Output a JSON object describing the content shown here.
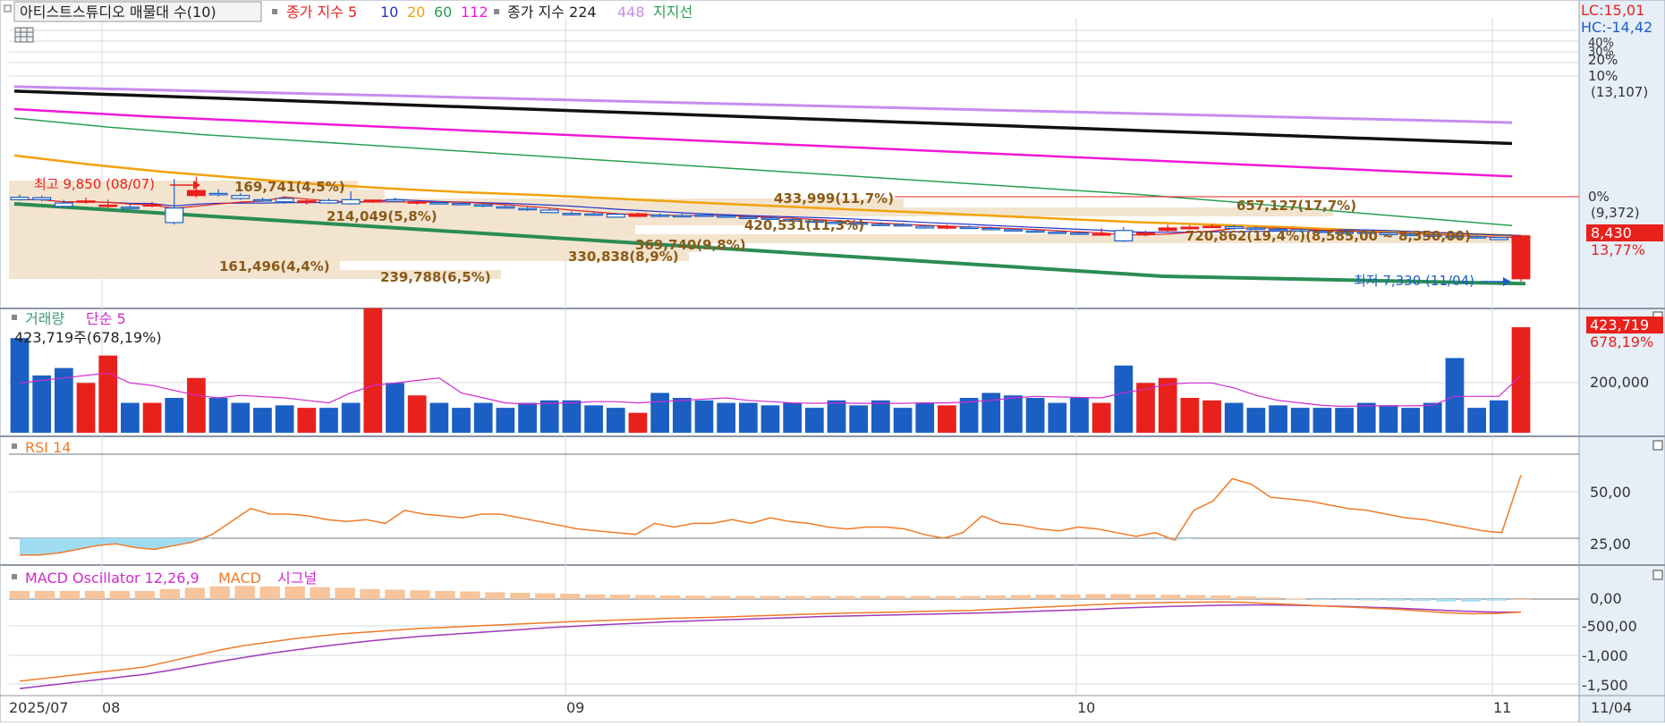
{
  "colors": {
    "up": "#e8211d",
    "down": "#1b5fc4",
    "ma5": "#e8211d",
    "ma10": "#2233cc",
    "ma20": "#f2a20c",
    "ma60": "#28a050",
    "ma112": "#f218d8",
    "ma224": "#111111",
    "ma448": "#c78cf0",
    "support": "#2b8c55",
    "volume_ma": "#d02ad0",
    "rsi": "#f07a28",
    "rsi_fill": "#9fdcf2",
    "macd": "#f07a28",
    "signal": "#a03ab8",
    "osc_pos": "#f7c49c",
    "osc_neg": "#a6def2",
    "axis_bg": "#e6eef8",
    "highlight_bg": "#e8211d",
    "profile_bar": "#f3e4cf"
  },
  "price_panel": {
    "legend": {
      "stock_label": "아티스트스튜디오 매물대 수(10)",
      "ma_prefix": "종가 지수 5",
      "ma10": "10",
      "ma20": "20",
      "ma60": "60",
      "ma112": "112",
      "ma224": "종가 지수 224",
      "ma448": "448",
      "support": "지지선"
    },
    "lc_label": "LC:15,01",
    "hc_label": "HC:-14,42",
    "axis_pct_labels": [
      "40%",
      "30%",
      "20%",
      "10%"
    ],
    "axis_pct_value": "(13,107)",
    "axis_zero_label": "0%",
    "axis_zero_value": "(9,372)",
    "current_price": "8,430",
    "current_change": "13,77%",
    "high_label": "최고 9,850 (08/07)",
    "low_label": "최저 7,330 (11/04)",
    "profile_labels": [
      "169,741(4,5%)",
      "214,049(5,8%)",
      "433,999(11,7%)",
      "657,127(17,7%)",
      "420,531(11,3%)",
      "369,740(9,8%)",
      "330,838(8,9%)",
      "161,496(4,4%)",
      "239,788(6,5%)",
      "720,862(19,4%)(8,585,00 ~ 8,350,00)"
    ]
  },
  "volume_panel": {
    "legend_name": "거래량",
    "legend_ma": "단순 5",
    "current_label": "423,719주(678,19%)",
    "axis_value": "423,719",
    "axis_pct": "678,19%",
    "axis_ticks": [
      "200,000"
    ]
  },
  "rsi_panel": {
    "legend": "RSI 14",
    "axis_ticks": [
      "50,00",
      "25,00"
    ]
  },
  "macd_panel": {
    "legend_osc": "MACD Oscillator 12,26,9",
    "legend_macd": "MACD",
    "legend_signal": "시그널",
    "axis_ticks": [
      "0,00",
      "-500,00",
      "-1,000",
      "-1,500"
    ]
  },
  "x_axis": {
    "labels": [
      "2025/07",
      "08",
      "09",
      "10",
      "11"
    ],
    "end_label": "11/04"
  },
  "chart_data": {
    "type": "candlestick",
    "candles": [
      {
        "o": 9360,
        "h": 9420,
        "l": 9280,
        "c": 9300
      },
      {
        "o": 9350,
        "h": 9400,
        "l": 9260,
        "c": 9300
      },
      {
        "o": 9220,
        "h": 9300,
        "l": 9120,
        "c": 9140
      },
      {
        "o": 9250,
        "h": 9350,
        "l": 9200,
        "c": 9270
      },
      {
        "o": 9160,
        "h": 9300,
        "l": 9100,
        "c": 9170
      },
      {
        "o": 9120,
        "h": 9200,
        "l": 9070,
        "c": 9100
      },
      {
        "o": 9180,
        "h": 9250,
        "l": 9120,
        "c": 9180
      },
      {
        "o": 9100,
        "h": 9800,
        "l": 8700,
        "c": 8750
      },
      {
        "o": 9400,
        "h": 9850,
        "l": 9350,
        "c": 9520
      },
      {
        "o": 9450,
        "h": 9550,
        "l": 9380,
        "c": 9430
      },
      {
        "o": 9400,
        "h": 9460,
        "l": 9300,
        "c": 9330
      },
      {
        "o": 9300,
        "h": 9350,
        "l": 9250,
        "c": 9290
      },
      {
        "o": 9330,
        "h": 9380,
        "l": 9200,
        "c": 9250
      },
      {
        "o": 9260,
        "h": 9320,
        "l": 9180,
        "c": 9270
      },
      {
        "o": 9280,
        "h": 9330,
        "l": 9200,
        "c": 9220
      },
      {
        "o": 9300,
        "h": 9500,
        "l": 9180,
        "c": 9200
      },
      {
        "o": 9250,
        "h": 9310,
        "l": 9220,
        "c": 9290
      },
      {
        "o": 9300,
        "h": 9350,
        "l": 9240,
        "c": 9260
      },
      {
        "o": 9230,
        "h": 9290,
        "l": 9180,
        "c": 9250
      },
      {
        "o": 9230,
        "h": 9260,
        "l": 9190,
        "c": 9210
      },
      {
        "o": 9210,
        "h": 9250,
        "l": 9170,
        "c": 9190
      },
      {
        "o": 9180,
        "h": 9220,
        "l": 9120,
        "c": 9150
      },
      {
        "o": 9130,
        "h": 9180,
        "l": 9080,
        "c": 9100
      },
      {
        "o": 9090,
        "h": 9130,
        "l": 9030,
        "c": 9060
      },
      {
        "o": 9050,
        "h": 9090,
        "l": 8980,
        "c": 8990
      },
      {
        "o": 8970,
        "h": 9020,
        "l": 8920,
        "c": 8950
      },
      {
        "o": 8960,
        "h": 9010,
        "l": 8920,
        "c": 8940
      },
      {
        "o": 8950,
        "h": 8990,
        "l": 8860,
        "c": 8880
      },
      {
        "o": 8900,
        "h": 8990,
        "l": 8880,
        "c": 8960
      },
      {
        "o": 8930,
        "h": 8970,
        "l": 8880,
        "c": 8920
      },
      {
        "o": 8920,
        "h": 8960,
        "l": 8880,
        "c": 8900
      },
      {
        "o": 8930,
        "h": 8960,
        "l": 8880,
        "c": 8910
      },
      {
        "o": 8910,
        "h": 8940,
        "l": 8860,
        "c": 8880
      },
      {
        "o": 8880,
        "h": 8920,
        "l": 8840,
        "c": 8860
      },
      {
        "o": 8860,
        "h": 8900,
        "l": 8810,
        "c": 8830
      },
      {
        "o": 8820,
        "h": 8860,
        "l": 8770,
        "c": 8790
      },
      {
        "o": 8790,
        "h": 8830,
        "l": 8740,
        "c": 8760
      },
      {
        "o": 8760,
        "h": 8800,
        "l": 8710,
        "c": 8730
      },
      {
        "o": 8740,
        "h": 8780,
        "l": 8700,
        "c": 8720
      },
      {
        "o": 8710,
        "h": 8760,
        "l": 8660,
        "c": 8680
      },
      {
        "o": 8700,
        "h": 8740,
        "l": 8650,
        "c": 8670
      },
      {
        "o": 8660,
        "h": 8700,
        "l": 8600,
        "c": 8620
      },
      {
        "o": 8640,
        "h": 8700,
        "l": 8590,
        "c": 8650
      },
      {
        "o": 8640,
        "h": 8680,
        "l": 8600,
        "c": 8620
      },
      {
        "o": 8610,
        "h": 8650,
        "l": 8560,
        "c": 8580
      },
      {
        "o": 8580,
        "h": 8620,
        "l": 8540,
        "c": 8560
      },
      {
        "o": 8550,
        "h": 8590,
        "l": 8500,
        "c": 8520
      },
      {
        "o": 8520,
        "h": 8560,
        "l": 8480,
        "c": 8500
      },
      {
        "o": 8500,
        "h": 8540,
        "l": 8450,
        "c": 8470
      },
      {
        "o": 8480,
        "h": 8620,
        "l": 8470,
        "c": 8480
      },
      {
        "o": 8560,
        "h": 8640,
        "l": 8280,
        "c": 8310
      },
      {
        "o": 8480,
        "h": 8560,
        "l": 8420,
        "c": 8500
      },
      {
        "o": 8560,
        "h": 8700,
        "l": 8520,
        "c": 8620
      },
      {
        "o": 8600,
        "h": 8690,
        "l": 8580,
        "c": 8640
      },
      {
        "o": 8660,
        "h": 8720,
        "l": 8620,
        "c": 8660
      },
      {
        "o": 8650,
        "h": 8700,
        "l": 8580,
        "c": 8610
      },
      {
        "o": 8620,
        "h": 8660,
        "l": 8560,
        "c": 8600
      },
      {
        "o": 8590,
        "h": 8630,
        "l": 8530,
        "c": 8560
      },
      {
        "o": 8580,
        "h": 8610,
        "l": 8520,
        "c": 8540
      },
      {
        "o": 8540,
        "h": 8580,
        "l": 8500,
        "c": 8520
      },
      {
        "o": 8520,
        "h": 8560,
        "l": 8480,
        "c": 8510
      },
      {
        "o": 8520,
        "h": 8550,
        "l": 8470,
        "c": 8490
      },
      {
        "o": 8500,
        "h": 8530,
        "l": 8440,
        "c": 8460
      },
      {
        "o": 8470,
        "h": 8510,
        "l": 8420,
        "c": 8440
      },
      {
        "o": 8450,
        "h": 8480,
        "l": 8390,
        "c": 8420
      },
      {
        "o": 8420,
        "h": 8460,
        "l": 8380,
        "c": 8400
      },
      {
        "o": 8410,
        "h": 8440,
        "l": 8360,
        "c": 8380
      },
      {
        "o": 8390,
        "h": 8400,
        "l": 8330,
        "c": 8340
      },
      {
        "o": 7400,
        "h": 8430,
        "l": 7330,
        "c": 8430
      }
    ],
    "volume": [
      380000,
      230000,
      260000,
      200000,
      310000,
      120000,
      120000,
      140000,
      220000,
      140000,
      120000,
      100000,
      110000,
      100000,
      100000,
      120000,
      500000,
      200000,
      150000,
      120000,
      100000,
      120000,
      100000,
      120000,
      130000,
      130000,
      110000,
      100000,
      80000,
      160000,
      140000,
      130000,
      120000,
      120000,
      110000,
      120000,
      100000,
      130000,
      110000,
      130000,
      100000,
      120000,
      110000,
      140000,
      160000,
      150000,
      140000,
      120000,
      140000,
      120000,
      270000,
      200000,
      220000,
      140000,
      130000,
      120000,
      100000,
      110000,
      100000,
      100000,
      100000,
      120000,
      110000,
      100000,
      120000,
      300000,
      100000,
      130000,
      423719
    ],
    "volume_ma5": [
      200000,
      210000,
      220000,
      230000,
      240000,
      200000,
      190000,
      170000,
      150000,
      140000,
      150000,
      145000,
      140000,
      130000,
      120000,
      160000,
      190000,
      200000,
      210000,
      220000,
      160000,
      140000,
      120000,
      115000,
      118000,
      120000,
      125000,
      125000,
      120000,
      125000,
      130000,
      135000,
      140000,
      130000,
      125000,
      120000,
      118000,
      120000,
      118000,
      118000,
      118000,
      120000,
      120000,
      124000,
      130000,
      140000,
      146000,
      144000,
      142000,
      140000,
      160000,
      175000,
      195000,
      200000,
      200000,
      180000,
      150000,
      130000,
      120000,
      110000,
      106000,
      108000,
      108000,
      108000,
      110000,
      146000,
      146000,
      146000,
      230000
    ],
    "rsi14": [
      16,
      16,
      17,
      19,
      21,
      22,
      20,
      19,
      21,
      23,
      27,
      34,
      41,
      38,
      38,
      37,
      35,
      34,
      35,
      33,
      40,
      38,
      37,
      36,
      38,
      38,
      36,
      34,
      32,
      30,
      29,
      28,
      27,
      33,
      31,
      33,
      33,
      35,
      33,
      36,
      34,
      33,
      31,
      30,
      31,
      31,
      30,
      27,
      25,
      28,
      37,
      33,
      32,
      30,
      29,
      31,
      30,
      28,
      26,
      28,
      24,
      40,
      45,
      57,
      54,
      47,
      46,
      45,
      43,
      41,
      40,
      38,
      36,
      35,
      33,
      31,
      29,
      28,
      59
    ],
    "macd": [
      -1450,
      -1400,
      -1350,
      -1300,
      -1250,
      -1200,
      -1100,
      -1000,
      -900,
      -820,
      -760,
      -700,
      -650,
      -610,
      -580,
      -550,
      -520,
      -500,
      -480,
      -460,
      -440,
      -420,
      -400,
      -385,
      -370,
      -355,
      -340,
      -330,
      -320,
      -305,
      -290,
      -275,
      -260,
      -250,
      -240,
      -230,
      -220,
      -210,
      -200,
      -180,
      -160,
      -140,
      -120,
      -100,
      -80,
      -70,
      -60,
      -55,
      -50,
      -60,
      -80,
      -100,
      -120,
      -140,
      -160,
      -180,
      -210,
      -240,
      -260,
      -255,
      -230
    ],
    "signal": [
      -1580,
      -1530,
      -1480,
      -1430,
      -1380,
      -1330,
      -1260,
      -1180,
      -1100,
      -1030,
      -960,
      -900,
      -840,
      -790,
      -740,
      -700,
      -660,
      -630,
      -600,
      -570,
      -540,
      -510,
      -485,
      -460,
      -440,
      -420,
      -400,
      -385,
      -370,
      -355,
      -340,
      -325,
      -310,
      -300,
      -290,
      -280,
      -270,
      -260,
      -250,
      -240,
      -225,
      -210,
      -195,
      -180,
      -160,
      -145,
      -130,
      -120,
      -110,
      -105,
      -105,
      -110,
      -120,
      -130,
      -145,
      -160,
      -180,
      -200,
      -220,
      -230,
      -230
    ],
    "oscillator": [
      130,
      130,
      130,
      130,
      130,
      130,
      160,
      180,
      200,
      210,
      200,
      200,
      190,
      180,
      160,
      150,
      140,
      130,
      120,
      110,
      100,
      90,
      85,
      75,
      70,
      65,
      60,
      55,
      50,
      50,
      50,
      50,
      50,
      50,
      50,
      50,
      50,
      50,
      50,
      60,
      65,
      70,
      75,
      80,
      80,
      75,
      70,
      65,
      60,
      45,
      25,
      10,
      -5,
      -15,
      -20,
      -25,
      -30,
      -40,
      -40,
      -25,
      0
    ],
    "moving_averages": {
      "ma20": [
        10750,
        10450,
        10200,
        10000,
        9800,
        9650,
        9520,
        9430,
        9330,
        9240,
        9160,
        9080,
        9000,
        8920,
        8840,
        8760,
        8700,
        8640,
        8560,
        8500,
        8440
      ],
      "ma60": [
        12000,
        11700,
        11450,
        11250,
        11050,
        10850,
        10650,
        10450,
        10250,
        10050,
        9850,
        9650,
        9450,
        9250,
        9050,
        8860,
        8680
      ],
      "ma112": [
        12300,
        12050,
        11850,
        11650,
        11450,
        11250,
        11050,
        10850,
        10650,
        10450,
        10250,
        10050
      ],
      "ma224": [
        12900,
        12650,
        12400,
        12150,
        11900,
        11650,
        11400,
        11150
      ],
      "ma448": [
        13050,
        12900,
        12750,
        12600,
        12450,
        12300,
        12150,
        12000,
        11850
      ]
    },
    "high": {
      "value": 9850,
      "date": "08/07"
    },
    "low": {
      "value": 7330,
      "date": "11/04"
    },
    "x_labels": [
      "2025/07",
      "08",
      "09",
      "10",
      "11"
    ]
  }
}
